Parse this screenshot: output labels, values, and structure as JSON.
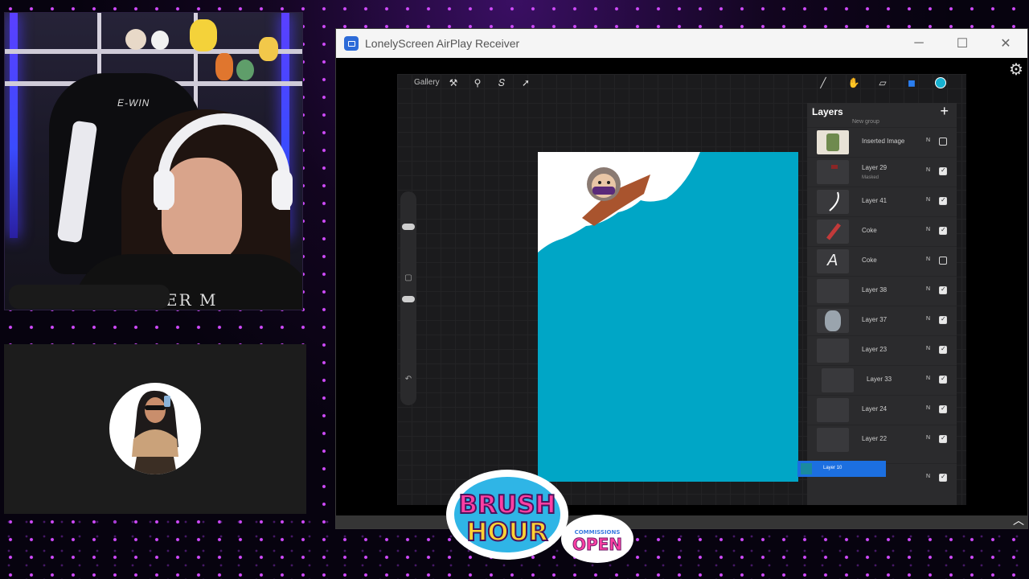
{
  "window": {
    "title": "LonelyScreen AirPlay Receiver",
    "controls": {
      "minimize": "─",
      "maximize": "☐",
      "close": "✕"
    }
  },
  "procreate": {
    "toolbar": {
      "gallery_label": "Gallery",
      "tools": [
        "wrench-icon",
        "magic-wand-icon",
        "selection-icon",
        "transform-icon"
      ],
      "right_tools": [
        "brush-icon",
        "smudge-icon",
        "eraser-icon",
        "layers-icon"
      ],
      "current_color": "#17b0cf"
    },
    "canvas": {
      "background_color": "#00a6c6"
    },
    "layers_panel": {
      "title": "Layers",
      "add_label": "+",
      "group_label": "New group",
      "layers": [
        {
          "name": "Inserted Image",
          "sub": "",
          "mode": "N",
          "visible": false
        },
        {
          "name": "Layer 29",
          "sub": "Masked",
          "mode": "N",
          "visible": true
        },
        {
          "name": "Layer 41",
          "sub": "",
          "mode": "N",
          "visible": true
        },
        {
          "name": "Coke",
          "sub": "",
          "mode": "N",
          "visible": true
        },
        {
          "name": "Coke",
          "sub": "",
          "mode": "N",
          "visible": false
        },
        {
          "name": "Layer 38",
          "sub": "",
          "mode": "N",
          "visible": true
        },
        {
          "name": "Layer 37",
          "sub": "",
          "mode": "N",
          "visible": true
        },
        {
          "name": "Layer 23",
          "sub": "",
          "mode": "N",
          "visible": true
        },
        {
          "name": "Layer 33",
          "sub": "",
          "mode": "N",
          "visible": true
        },
        {
          "name": "Layer 24",
          "sub": "",
          "mode": "N",
          "visible": true
        },
        {
          "name": "Layer 22",
          "sub": "",
          "mode": "N",
          "visible": true
        }
      ],
      "selected_layer": {
        "name": "Layer 10"
      },
      "last_mode": "N"
    }
  },
  "overlay": {
    "logo_line1": "BRUSH",
    "logo_line2": "HOUR",
    "commissions_small": "COMMISSIONS",
    "commissions_big": "OPEN",
    "chair_brand": "E-WIN",
    "shirt_text": "ER M"
  }
}
